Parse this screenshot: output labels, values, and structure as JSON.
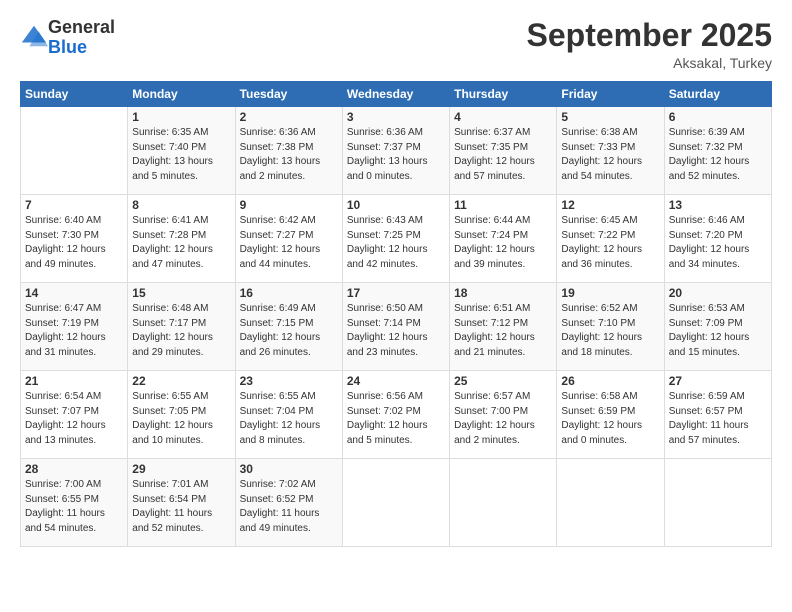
{
  "logo": {
    "general": "General",
    "blue": "Blue"
  },
  "header": {
    "month": "September 2025",
    "location": "Aksakal, Turkey"
  },
  "days_of_week": [
    "Sunday",
    "Monday",
    "Tuesday",
    "Wednesday",
    "Thursday",
    "Friday",
    "Saturday"
  ],
  "weeks": [
    [
      {
        "day": "",
        "sunrise": "",
        "sunset": "",
        "daylight": ""
      },
      {
        "day": "1",
        "sunrise": "Sunrise: 6:35 AM",
        "sunset": "Sunset: 7:40 PM",
        "daylight": "Daylight: 13 hours and 5 minutes."
      },
      {
        "day": "2",
        "sunrise": "Sunrise: 6:36 AM",
        "sunset": "Sunset: 7:38 PM",
        "daylight": "Daylight: 13 hours and 2 minutes."
      },
      {
        "day": "3",
        "sunrise": "Sunrise: 6:36 AM",
        "sunset": "Sunset: 7:37 PM",
        "daylight": "Daylight: 13 hours and 0 minutes."
      },
      {
        "day": "4",
        "sunrise": "Sunrise: 6:37 AM",
        "sunset": "Sunset: 7:35 PM",
        "daylight": "Daylight: 12 hours and 57 minutes."
      },
      {
        "day": "5",
        "sunrise": "Sunrise: 6:38 AM",
        "sunset": "Sunset: 7:33 PM",
        "daylight": "Daylight: 12 hours and 54 minutes."
      },
      {
        "day": "6",
        "sunrise": "Sunrise: 6:39 AM",
        "sunset": "Sunset: 7:32 PM",
        "daylight": "Daylight: 12 hours and 52 minutes."
      }
    ],
    [
      {
        "day": "7",
        "sunrise": "Sunrise: 6:40 AM",
        "sunset": "Sunset: 7:30 PM",
        "daylight": "Daylight: 12 hours and 49 minutes."
      },
      {
        "day": "8",
        "sunrise": "Sunrise: 6:41 AM",
        "sunset": "Sunset: 7:28 PM",
        "daylight": "Daylight: 12 hours and 47 minutes."
      },
      {
        "day": "9",
        "sunrise": "Sunrise: 6:42 AM",
        "sunset": "Sunset: 7:27 PM",
        "daylight": "Daylight: 12 hours and 44 minutes."
      },
      {
        "day": "10",
        "sunrise": "Sunrise: 6:43 AM",
        "sunset": "Sunset: 7:25 PM",
        "daylight": "Daylight: 12 hours and 42 minutes."
      },
      {
        "day": "11",
        "sunrise": "Sunrise: 6:44 AM",
        "sunset": "Sunset: 7:24 PM",
        "daylight": "Daylight: 12 hours and 39 minutes."
      },
      {
        "day": "12",
        "sunrise": "Sunrise: 6:45 AM",
        "sunset": "Sunset: 7:22 PM",
        "daylight": "Daylight: 12 hours and 36 minutes."
      },
      {
        "day": "13",
        "sunrise": "Sunrise: 6:46 AM",
        "sunset": "Sunset: 7:20 PM",
        "daylight": "Daylight: 12 hours and 34 minutes."
      }
    ],
    [
      {
        "day": "14",
        "sunrise": "Sunrise: 6:47 AM",
        "sunset": "Sunset: 7:19 PM",
        "daylight": "Daylight: 12 hours and 31 minutes."
      },
      {
        "day": "15",
        "sunrise": "Sunrise: 6:48 AM",
        "sunset": "Sunset: 7:17 PM",
        "daylight": "Daylight: 12 hours and 29 minutes."
      },
      {
        "day": "16",
        "sunrise": "Sunrise: 6:49 AM",
        "sunset": "Sunset: 7:15 PM",
        "daylight": "Daylight: 12 hours and 26 minutes."
      },
      {
        "day": "17",
        "sunrise": "Sunrise: 6:50 AM",
        "sunset": "Sunset: 7:14 PM",
        "daylight": "Daylight: 12 hours and 23 minutes."
      },
      {
        "day": "18",
        "sunrise": "Sunrise: 6:51 AM",
        "sunset": "Sunset: 7:12 PM",
        "daylight": "Daylight: 12 hours and 21 minutes."
      },
      {
        "day": "19",
        "sunrise": "Sunrise: 6:52 AM",
        "sunset": "Sunset: 7:10 PM",
        "daylight": "Daylight: 12 hours and 18 minutes."
      },
      {
        "day": "20",
        "sunrise": "Sunrise: 6:53 AM",
        "sunset": "Sunset: 7:09 PM",
        "daylight": "Daylight: 12 hours and 15 minutes."
      }
    ],
    [
      {
        "day": "21",
        "sunrise": "Sunrise: 6:54 AM",
        "sunset": "Sunset: 7:07 PM",
        "daylight": "Daylight: 12 hours and 13 minutes."
      },
      {
        "day": "22",
        "sunrise": "Sunrise: 6:55 AM",
        "sunset": "Sunset: 7:05 PM",
        "daylight": "Daylight: 12 hours and 10 minutes."
      },
      {
        "day": "23",
        "sunrise": "Sunrise: 6:55 AM",
        "sunset": "Sunset: 7:04 PM",
        "daylight": "Daylight: 12 hours and 8 minutes."
      },
      {
        "day": "24",
        "sunrise": "Sunrise: 6:56 AM",
        "sunset": "Sunset: 7:02 PM",
        "daylight": "Daylight: 12 hours and 5 minutes."
      },
      {
        "day": "25",
        "sunrise": "Sunrise: 6:57 AM",
        "sunset": "Sunset: 7:00 PM",
        "daylight": "Daylight: 12 hours and 2 minutes."
      },
      {
        "day": "26",
        "sunrise": "Sunrise: 6:58 AM",
        "sunset": "Sunset: 6:59 PM",
        "daylight": "Daylight: 12 hours and 0 minutes."
      },
      {
        "day": "27",
        "sunrise": "Sunrise: 6:59 AM",
        "sunset": "Sunset: 6:57 PM",
        "daylight": "Daylight: 11 hours and 57 minutes."
      }
    ],
    [
      {
        "day": "28",
        "sunrise": "Sunrise: 7:00 AM",
        "sunset": "Sunset: 6:55 PM",
        "daylight": "Daylight: 11 hours and 54 minutes."
      },
      {
        "day": "29",
        "sunrise": "Sunrise: 7:01 AM",
        "sunset": "Sunset: 6:54 PM",
        "daylight": "Daylight: 11 hours and 52 minutes."
      },
      {
        "day": "30",
        "sunrise": "Sunrise: 7:02 AM",
        "sunset": "Sunset: 6:52 PM",
        "daylight": "Daylight: 11 hours and 49 minutes."
      },
      {
        "day": "",
        "sunrise": "",
        "sunset": "",
        "daylight": ""
      },
      {
        "day": "",
        "sunrise": "",
        "sunset": "",
        "daylight": ""
      },
      {
        "day": "",
        "sunrise": "",
        "sunset": "",
        "daylight": ""
      },
      {
        "day": "",
        "sunrise": "",
        "sunset": "",
        "daylight": ""
      }
    ]
  ]
}
